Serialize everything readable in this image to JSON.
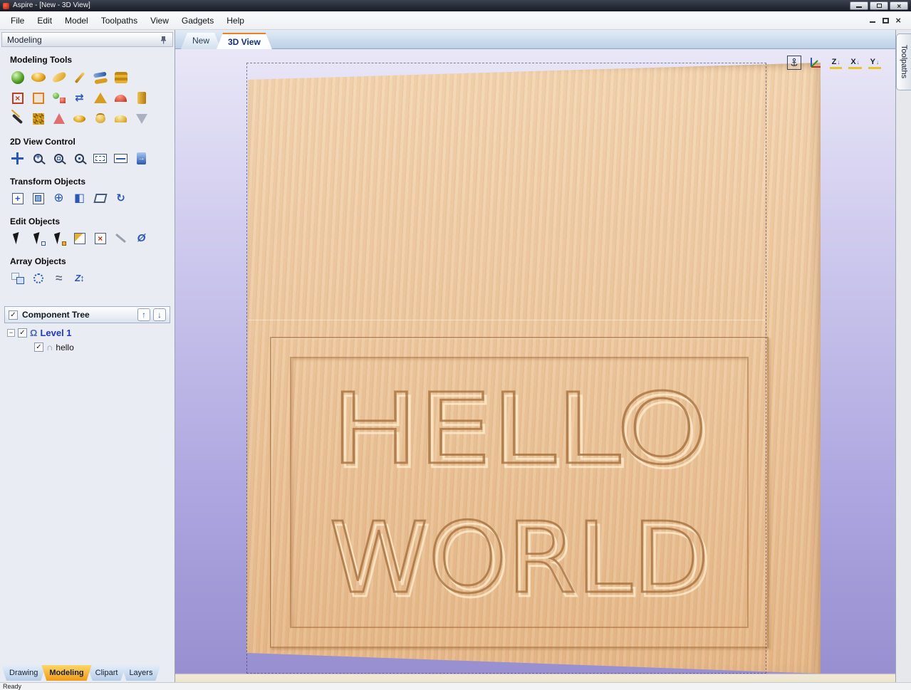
{
  "window": {
    "title": "Aspire - [New - 3D View]"
  },
  "menu": {
    "items": [
      "File",
      "Edit",
      "Model",
      "Toolpaths",
      "View",
      "Gadgets",
      "Help"
    ]
  },
  "sidebar": {
    "title": "Modeling",
    "sections": {
      "modeling_tools": "Modeling Tools",
      "view_control": "2D View Control",
      "transform": "Transform Objects",
      "edit": "Edit Objects",
      "array": "Array Objects"
    },
    "component_tree": {
      "title": "Component Tree",
      "items": [
        {
          "label": "Level 1",
          "checked": true
        },
        {
          "label": "hello",
          "checked": true
        }
      ]
    },
    "tabs": [
      "Drawing",
      "Modeling",
      "Clipart",
      "Layers"
    ],
    "active_tab": "Modeling"
  },
  "main": {
    "tabs": [
      "New",
      "3D View"
    ],
    "active_tab": "3D View",
    "axis_buttons": [
      "Z",
      "X",
      "Y"
    ],
    "toolpaths_tab": "Toolpaths",
    "carving": {
      "line1": "HELLO",
      "line2": "WORLD"
    }
  },
  "statusbar": {
    "text": "Ready"
  },
  "colors": {
    "wood": "#eac094",
    "background_top": "#e9e7f7",
    "background_bottom": "#988fd0",
    "active_tab_orange": "#f09a16",
    "tree_label_blue": "#2038c8"
  }
}
